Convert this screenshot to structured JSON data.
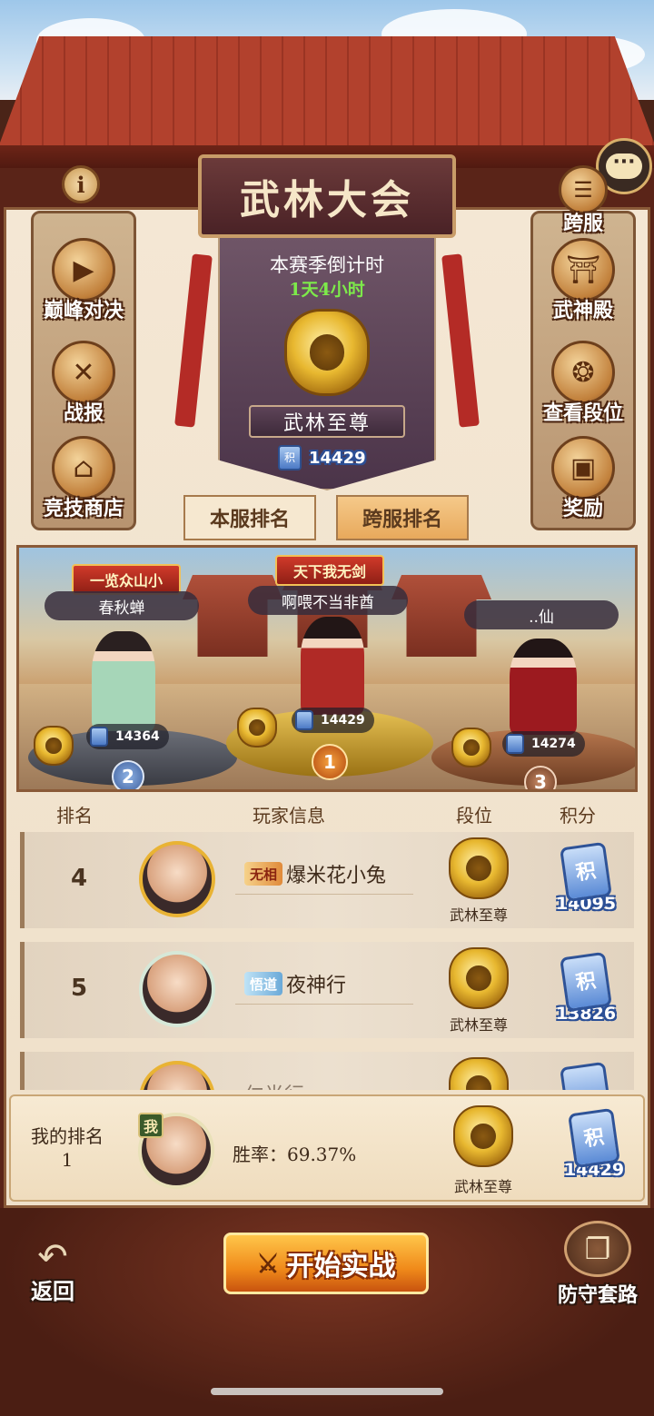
{
  "header": {
    "title": "武林大会",
    "info_icon": "info-icon",
    "chat_icon": "chat-bubble-icon"
  },
  "season": {
    "countdown_label": "本赛季倒计时",
    "countdown_value": "1天4小时",
    "tier_name": "武林至尊",
    "score_token": "积",
    "score": "14429"
  },
  "left_menu": [
    {
      "label": "巅峰对决",
      "icon": "play-icon"
    },
    {
      "label": "战报",
      "icon": "crossed-swords-scroll-icon"
    },
    {
      "label": "竞技商店",
      "icon": "shop-icon"
    }
  ],
  "right_menu": [
    {
      "label": "跨服",
      "icon": "list-icon"
    },
    {
      "label": "武神殿",
      "icon": "hall-icon"
    },
    {
      "label": "查看段位",
      "icon": "dragon-icon"
    },
    {
      "label": "奖励",
      "icon": "treasure-chest-icon"
    }
  ],
  "tabs": {
    "local": "本服排名",
    "cross": "跨服排名",
    "active": "cross"
  },
  "podium": {
    "first": {
      "title": "天下我无剑",
      "name": "啊喂不当非酋",
      "score": "14429",
      "rank": "1"
    },
    "second": {
      "title": "一览众山小",
      "name": "春秋蝉",
      "score": "14364",
      "rank": "2"
    },
    "third": {
      "name": "..仙",
      "score": "14274",
      "rank": "3"
    }
  },
  "table": {
    "headers": {
      "rank": "排名",
      "player": "玩家信息",
      "tier": "段位",
      "score": "积分"
    },
    "rows": [
      {
        "rank": "4",
        "title": "无相",
        "name": "爆米花小兔",
        "tier": "武林至尊",
        "token": "积",
        "score": "14095"
      },
      {
        "rank": "5",
        "title": "悟道",
        "name": "夜神行",
        "tier": "武林至尊",
        "token": "积",
        "score": "13826"
      },
      {
        "partial_name": "仁半行"
      }
    ]
  },
  "my_rank": {
    "label": "我的排名",
    "rank": "1",
    "me_tag": "我",
    "win_rate": "胜率：69.37%",
    "tier": "武林至尊",
    "token": "积",
    "score": "14429"
  },
  "bottom": {
    "back_label": "返回",
    "start_label": "开始实战",
    "defense_label": "防守套路"
  }
}
